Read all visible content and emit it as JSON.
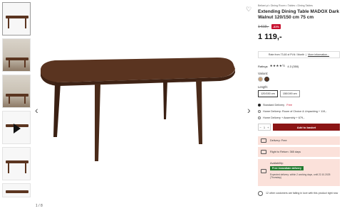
{
  "gallery": {
    "counter": "1 / 8",
    "thumbnails": [
      {
        "kind": "product"
      },
      {
        "kind": "room"
      },
      {
        "kind": "room"
      },
      {
        "kind": "video"
      },
      {
        "kind": "product"
      },
      {
        "kind": "product"
      }
    ]
  },
  "product": {
    "breadcrumb": "Beliani.pl • Dining Room • Tables • Dining Tables",
    "title": "Extending Dining Table MADOX Dark Walnut 120/150 cm 75 cm",
    "old_price": "1 619,-",
    "discount": "-31%",
    "price": "1 119,-",
    "finance_text": "Rate from 73,60 zł PLN / Month",
    "finance_link": "More information...",
    "ratings_label": "Ratings",
    "stars": "★★★★½",
    "rating_value": "4.3 (350)",
    "variant_label": "Variant:",
    "length_label": "Length:",
    "lengths": [
      "120/150 cm",
      "150/190 cm"
    ]
  },
  "delivery": {
    "options": [
      {
        "label": "Standard Delivery",
        "free": "Free",
        "selected": true
      },
      {
        "label": "Home Delivery: Room of Choice & Unpacking + 119,-",
        "free": "",
        "selected": false
      },
      {
        "label": "Home Delivery + Assembly + 679,-",
        "free": "",
        "selected": false
      }
    ]
  },
  "cart": {
    "qty_minus": "−",
    "qty": "1",
    "qty_plus": "+",
    "button": "Add to basket"
  },
  "info": {
    "delivery": "Delivery: Free",
    "returns": "Right to Return: 365 days",
    "availability_label": "Availability:",
    "availability_tag": "Free immediate delivery",
    "availability_note": "Expected delivery: within 2 working days, until 22.10.2025 (Thursday)",
    "social": "12 other customers are falling in love with this product right now"
  },
  "colors": {
    "accent": "#8b1515",
    "discount": "#c8102e",
    "info_bg": "#fbe1da",
    "available": "#1f7a2e",
    "wood": "#5b3520"
  }
}
